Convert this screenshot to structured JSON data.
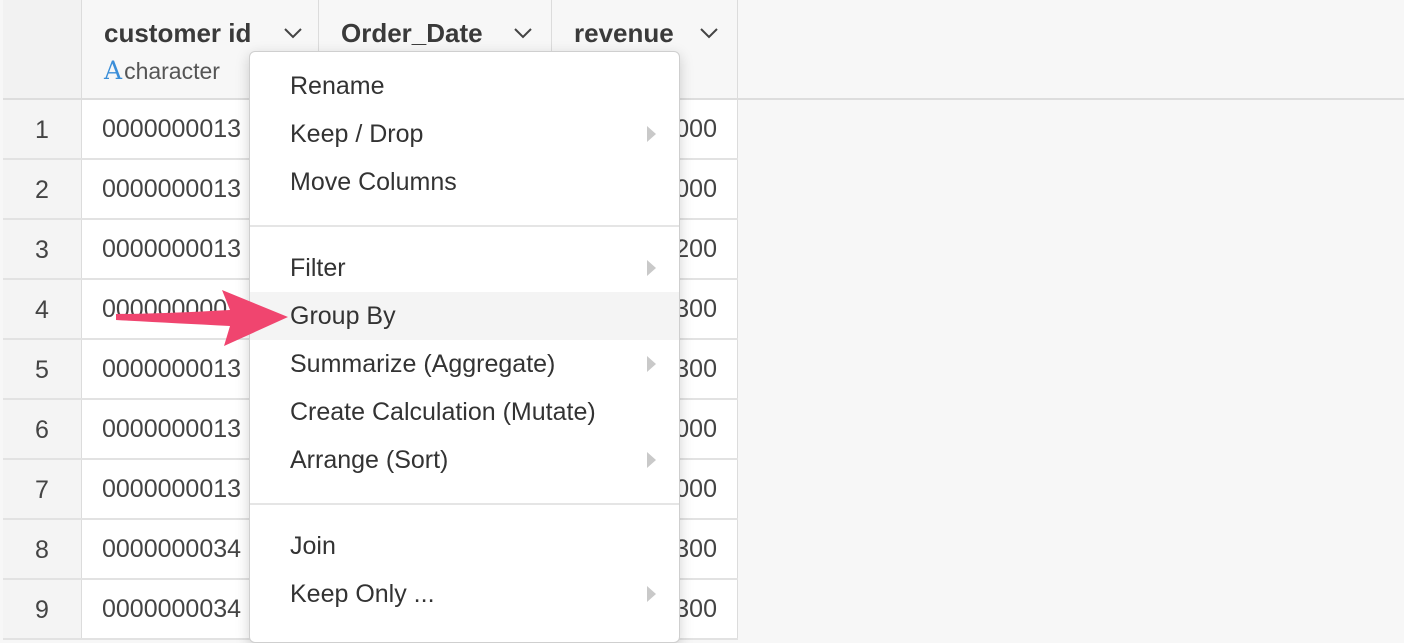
{
  "columns": [
    {
      "name": "customer id",
      "type_glyph": "A",
      "type_label": "character"
    },
    {
      "name": "Order_Date"
    },
    {
      "name": "revenue"
    }
  ],
  "rows": [
    {
      "num": "1",
      "customer_id": "0000000013",
      "revenue": "000"
    },
    {
      "num": "2",
      "customer_id": "0000000013",
      "revenue": "000"
    },
    {
      "num": "3",
      "customer_id": "0000000013",
      "revenue": "200"
    },
    {
      "num": "4",
      "customer_id": "000000000",
      "revenue": "300"
    },
    {
      "num": "5",
      "customer_id": "0000000013",
      "revenue": "300"
    },
    {
      "num": "6",
      "customer_id": "0000000013",
      "revenue": "000"
    },
    {
      "num": "7",
      "customer_id": "0000000013",
      "revenue": "000"
    },
    {
      "num": "8",
      "customer_id": "0000000034",
      "revenue": "300"
    },
    {
      "num": "9",
      "customer_id": "0000000034",
      "revenue": "300"
    }
  ],
  "menu": {
    "items": [
      {
        "label": "Rename",
        "submenu": false
      },
      {
        "label": "Keep / Drop",
        "submenu": true
      },
      {
        "label": "Move Columns",
        "submenu": false
      },
      {
        "label": "Filter",
        "submenu": true
      },
      {
        "label": "Group By",
        "submenu": false
      },
      {
        "label": "Summarize (Aggregate)",
        "submenu": true
      },
      {
        "label": "Create Calculation (Mutate)",
        "submenu": false
      },
      {
        "label": "Arrange (Sort)",
        "submenu": true
      },
      {
        "label": "Join",
        "submenu": false
      },
      {
        "label": "Keep Only ...",
        "submenu": true
      }
    ],
    "highlighted": "Group By"
  },
  "icons": {
    "column_dropdown": "chevron-down-icon",
    "submenu": "caret-right-icon",
    "annotation": "pink-arrow-icon"
  },
  "colors": {
    "highlight_bg": "#f4f4f4",
    "annotation_arrow": "#f0456f",
    "type_glyph": "#3b8ed8"
  }
}
